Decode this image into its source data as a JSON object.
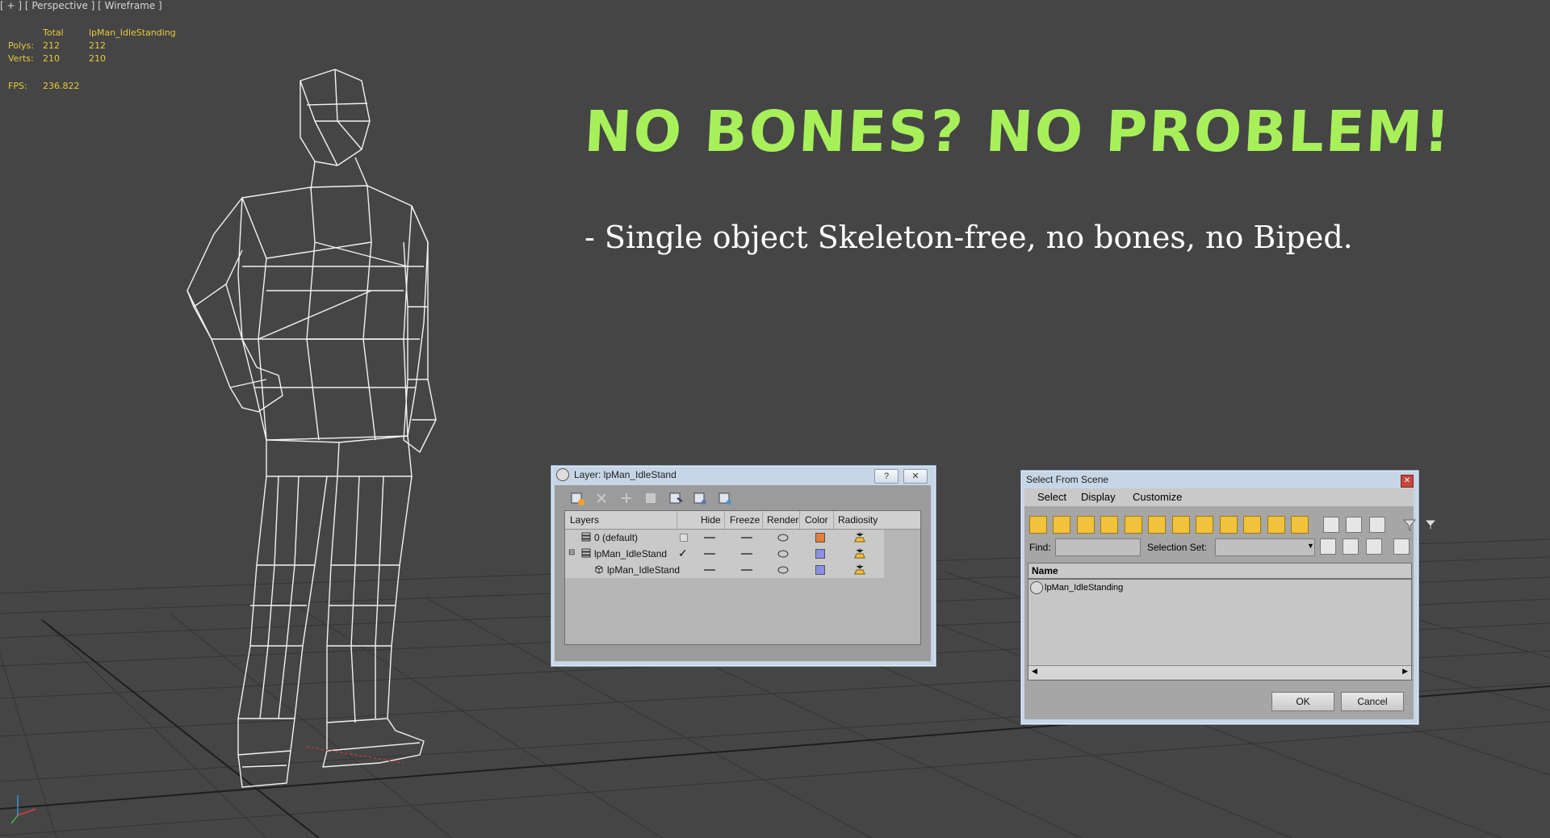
{
  "viewport": {
    "label": "[ + ] [ Perspective ] [ Wireframe ]",
    "stats": {
      "col_total": "Total",
      "col_object": "lpMan_IdleStanding",
      "polys_label": "Polys:",
      "polys_total": "212",
      "polys_object": "212",
      "verts_label": "Verts:",
      "verts_total": "210",
      "verts_object": "210",
      "fps_label": "FPS:",
      "fps_value": "236.822"
    },
    "headline": "NO BONES? NO PROBLEM!",
    "subline": "- Single object Skeleton-free, no bones, no Biped.",
    "colors": {
      "background": "#454545",
      "headline": "#a8f05a",
      "stats": "#e8c93c",
      "grid": "#2f2f2f"
    }
  },
  "layer_dialog": {
    "title": "Layer: lpMan_IdleStand",
    "help_button": "?",
    "close_button": "✕",
    "columns": [
      "Layers",
      "Hide",
      "Freeze",
      "Render",
      "Color",
      "Radiosity"
    ],
    "rows": [
      {
        "name": "0 (default)",
        "color": "#e67d3a"
      },
      {
        "name": "lpMan_IdleStand",
        "color": "#8a8fe6",
        "active_mark": "✓"
      },
      {
        "name": "lpMan_IdleStand",
        "color": "#8a8fe6"
      }
    ]
  },
  "select_dialog": {
    "title": "Select From Scene",
    "close_button": "✕",
    "menu": [
      "Select",
      "Display",
      "Customize"
    ],
    "find_label": "Find:",
    "find_value": "",
    "selection_set_label": "Selection Set:",
    "selection_set_value": "",
    "name_header": "Name",
    "items": [
      "lpMan_IdleStanding"
    ],
    "ok_label": "OK",
    "cancel_label": "Cancel"
  }
}
